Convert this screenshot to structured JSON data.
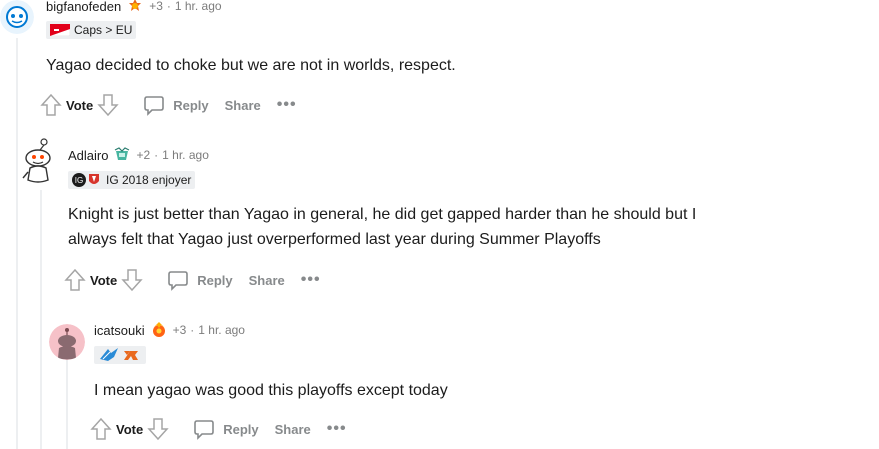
{
  "comments": [
    {
      "username": "bigfanofeden",
      "karma": "+3",
      "separator": "·",
      "time": "1 hr. ago",
      "flair": "Caps > EU",
      "text": "Yagao decided to choke but we are not in worlds, respect.",
      "actions": {
        "vote": "Vote",
        "reply": "Reply",
        "share": "Share",
        "more": "•••"
      }
    },
    {
      "username": "Adlairo",
      "karma": "+2",
      "separator": "·",
      "time": "1 hr. ago",
      "flair": "IG 2018 enjoyer",
      "text_lines": [
        "Knight is just better than Yagao in general, he did get gapped harder than he should but I",
        "always felt that Yagao just overperformed last year during Summer Playoffs"
      ],
      "actions": {
        "vote": "Vote",
        "reply": "Reply",
        "share": "Share",
        "more": "•••"
      }
    },
    {
      "username": "icatsouki",
      "karma": "+3",
      "separator": "·",
      "time": "1 hr. ago",
      "text": "I mean yagao was good this playoffs except today",
      "actions": {
        "vote": "Vote",
        "reply": "Reply",
        "share": "Share",
        "more": "•••"
      }
    }
  ],
  "colors": {
    "thread_line": "#edeff1",
    "meta_gray": "#7c7c7c",
    "action_gray": "#878a8c",
    "flair_bg": "#edeff1"
  },
  "icons": [
    "snoo-avatar-icon",
    "award-icon",
    "flag-icon",
    "team-logo-icon",
    "upvote-icon",
    "downvote-icon",
    "comment-bubble-icon"
  ]
}
